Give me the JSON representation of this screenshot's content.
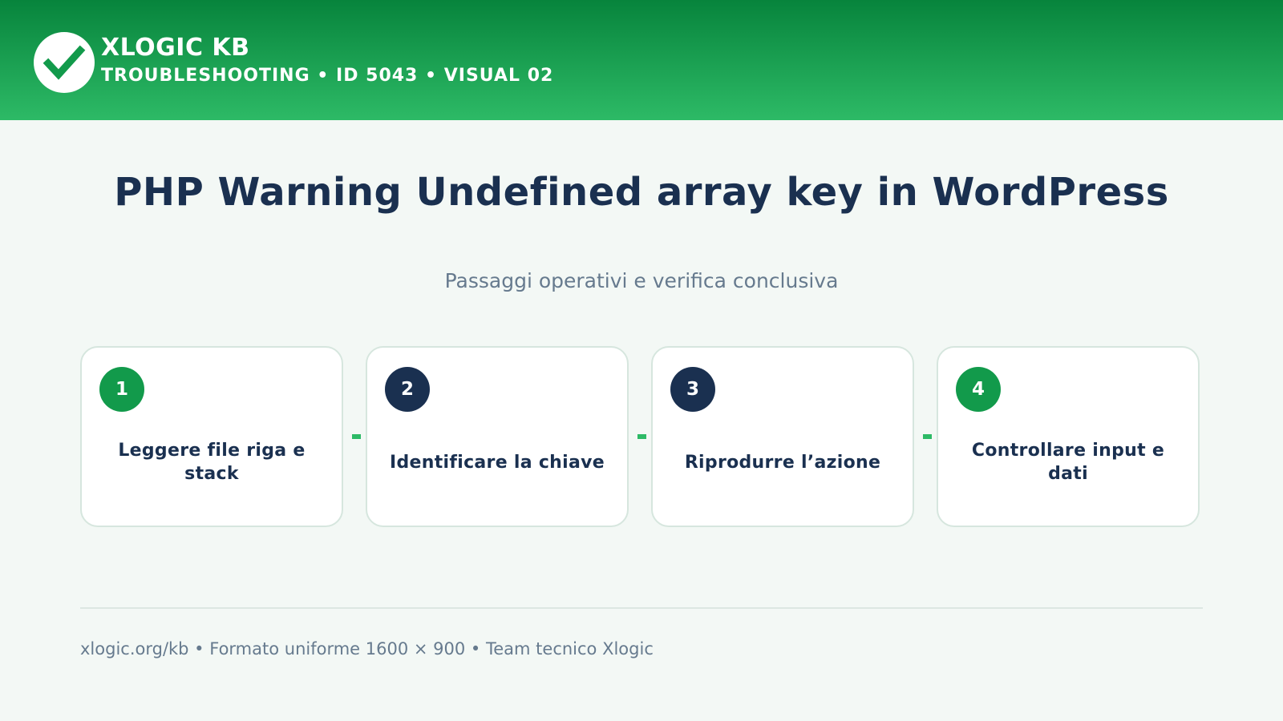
{
  "header": {
    "brand": "XLOGIC KB",
    "subtitle": "TROUBLESHOOTING • ID 5043 • VISUAL 02",
    "logo_icon": "checkmark-icon"
  },
  "main": {
    "title": "PHP Warning Undefined array key in WordPress",
    "subtitle": "Passaggi operativi e verifica conclusiva",
    "steps": [
      {
        "number": "1",
        "label": "Leggere file riga e stack",
        "badge_color": "#129a4b"
      },
      {
        "number": "2",
        "label": "Identificare la chiave",
        "badge_color": "#1a3050"
      },
      {
        "number": "3",
        "label": "Riprodurre l’azione",
        "badge_color": "#1a3050"
      },
      {
        "number": "4",
        "label": "Controllare input e dati",
        "badge_color": "#129a4b"
      }
    ]
  },
  "footer": {
    "text": "xlogic.org/kb • Formato uniforme 1600 × 900 • Team tecnico Xlogic"
  },
  "colors": {
    "header_gradient_top": "#07843c",
    "header_gradient_bottom": "#2dba66",
    "text_primary": "#1a3050",
    "text_muted": "#667a8e",
    "accent_green": "#129a4b",
    "connector": "#2dba66",
    "background": "#f3f8f5"
  }
}
